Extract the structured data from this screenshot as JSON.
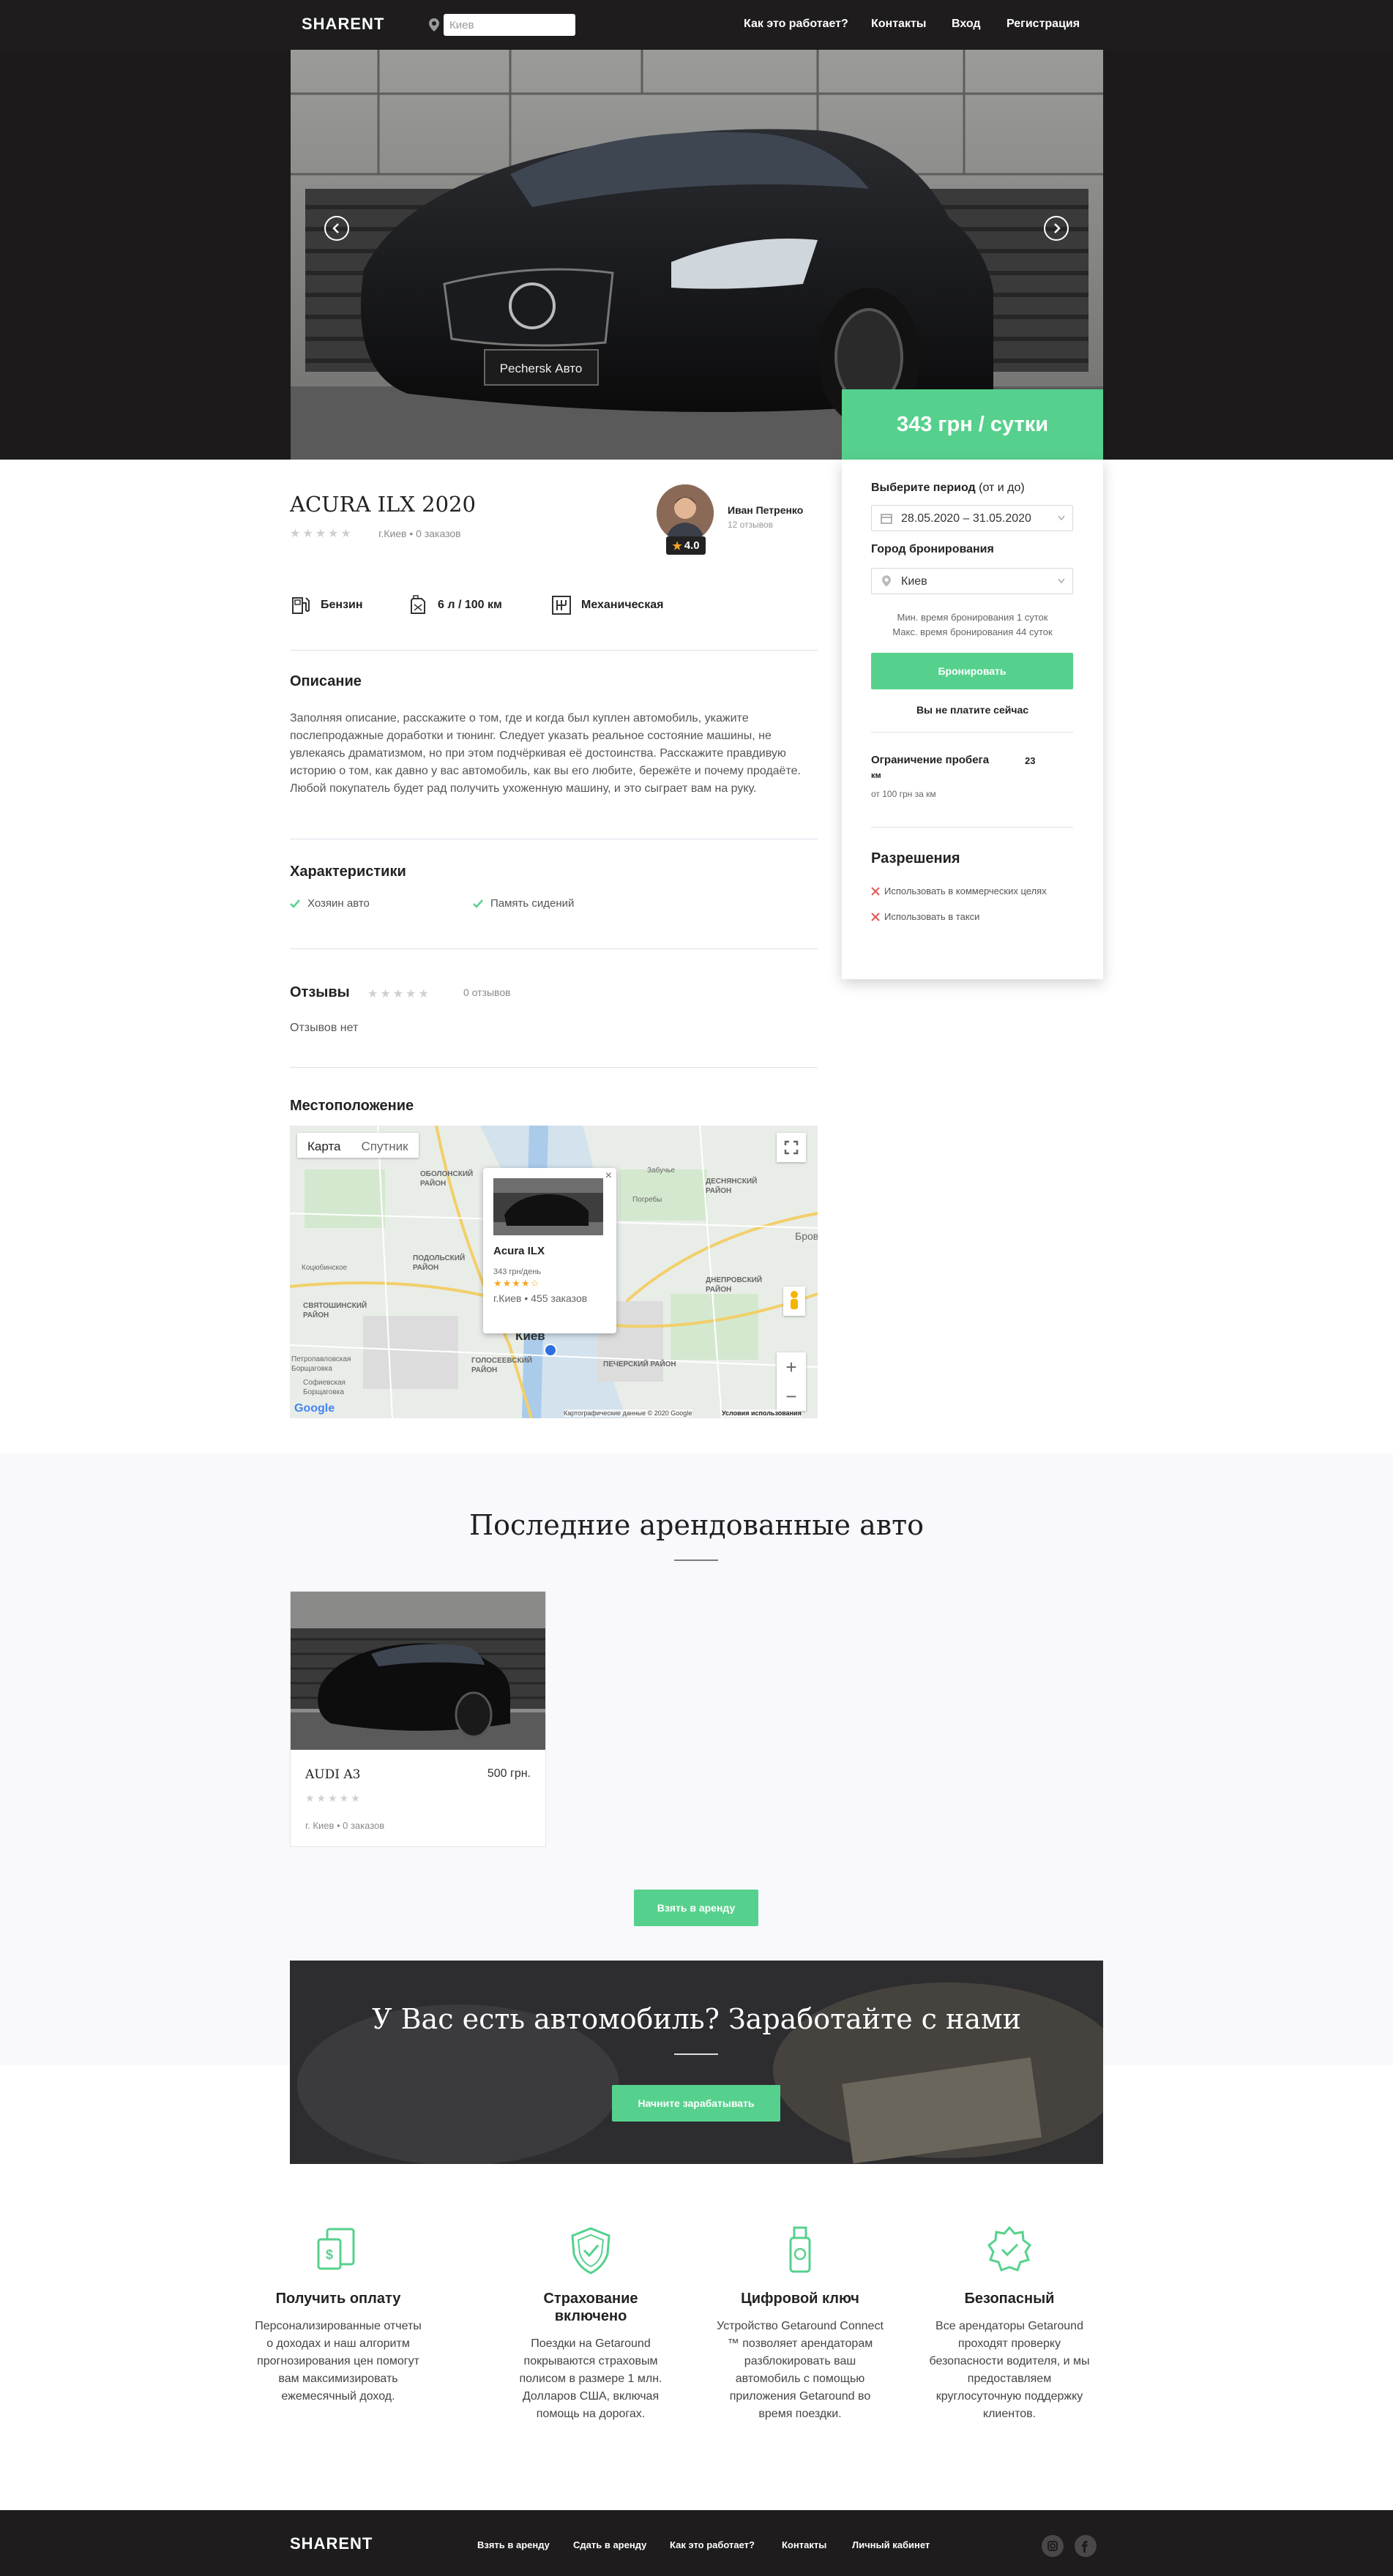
{
  "header": {
    "logo": "SHARENT",
    "search_value": "Киев",
    "nav": [
      "Как это работает?",
      "Контакты",
      "Вход",
      "Регистрация"
    ]
  },
  "hero": {
    "plate_text": "Pechersk Авто"
  },
  "price": {
    "label": "343 грн / сутки"
  },
  "booking": {
    "period_label": "Выберите период",
    "period_hint": "(от и до)",
    "dates": "28.05.2020 – 31.05.2020",
    "city_label": "Город бронирования",
    "city_value": "Киев",
    "min_time": "Мин. время бронирования 1 суток",
    "max_time": "Макс. время бронирования 44 суток",
    "book_button": "Бронировать",
    "no_pay": "Вы не платите сейчас",
    "mileage_label": "Ограничение пробега",
    "mileage_value": "23",
    "mileage_unit": "км",
    "mileage_price": "от 100 грн за км",
    "permissions_title": "Разрешения",
    "permissions": [
      "Использовать в коммерческих целях",
      "Использовать в такси"
    ]
  },
  "car": {
    "title": "ACURA ILX 2020",
    "stars": "★★★★★",
    "meta": "г.Киев • 0 заказов",
    "owner_name": "Иван Петренко",
    "owner_reviews": "12 отзывов",
    "owner_rating": "4.0",
    "specs": [
      "Бензин",
      "6 л / 100 км",
      "Механическая"
    ]
  },
  "description": {
    "title": "Описание",
    "text": "Заполняя описание, расскажите о том, где и когда был куплен автомобиль, укажите послепродажные доработки и тюнинг. Следует указать реальное состояние машины, не увлекаясь драматизмом, но при этом подчёркивая её достоинства. Расскажите правдивую историю о том, как давно у вас автомобиль, как вы его любите, бережёте и почему продаёте. Любой покупатель будет рад получить ухоженную машину, и это сыграет вам на руку."
  },
  "features": {
    "title": "Характеристики",
    "items": [
      "Хозяин авто",
      "Память сидений"
    ]
  },
  "reviews": {
    "title": "Отзывы",
    "stars": "★★★★★",
    "count": "0 отзывов",
    "empty": "Отзывов нет"
  },
  "location": {
    "title": "Местоположение",
    "map_tab_map": "Карта",
    "map_tab_sat": "Спутник",
    "popup_title": "Acura ILX",
    "popup_price": "343 грн/день",
    "popup_stars": "★★★★☆",
    "popup_meta": "г.Киев • 455 заказов",
    "popup_close": "×",
    "city_label": "Киев",
    "districts": [
      "ОБОЛОНСКИЙ РАЙОН",
      "ПОДОЛЬСКИЙ РАЙОН",
      "СВЯТОШИНСКИЙ РАЙОН",
      "ДЕСНЯНСКИЙ РАЙОН",
      "ДНЕПРОВСКИЙ РАЙОН",
      "Коцюбинское",
      "Петропавловская Борщаговка",
      "Софиевская Борщаговка",
      "Погребы",
      "Бров",
      "ПЕЧЕРСКИЙ РАЙОН",
      "ГОЛОСЕЕВСКИЙ РАЙОН",
      "Забучье"
    ],
    "zoom_in": "+",
    "zoom_out": "−",
    "google": "Google",
    "attribution": "Картографические данные © 2020 Google",
    "terms": "Условия использования"
  },
  "recent": {
    "title": "Последние арендованные авто",
    "card_name": "AUDI A3",
    "card_price": "500 грн.",
    "card_stars": "★★★★★",
    "card_meta": "г. Киев • 0 заказов",
    "rent_button": "Взять в аренду"
  },
  "earn": {
    "title": "У Вас есть автомобиль? Заработайте с нами",
    "button": "Начните зарабатывать"
  },
  "benefits": [
    {
      "title": "Получить оплату",
      "text": "Персонализированные отчеты о доходах и наш алгоритм прогнозирования цен помогут вам максимизировать ежемесячный доход."
    },
    {
      "title": "Страхование включено",
      "text": "Поездки на Getaround покрываются страховым полисом в размере 1 млн. Долларов США, включая помощь на дорогах."
    },
    {
      "title": "Цифровой ключ",
      "text": "Устройство Getaround Connect ™ позволяет арендаторам разблокировать ваш автомобиль с помощью приложения Getaround во время поездки."
    },
    {
      "title": "Безопасный",
      "text": "Все арендаторы Getaround проходят проверку безопасности водителя, и мы предоставляем круглосуточную поддержку клиентов."
    }
  ],
  "footer": {
    "logo": "SHARENT",
    "links": [
      "Взять в аренду",
      "Сдать в аренду",
      "Как это работает?",
      "Контакты",
      "Личный кабинет"
    ]
  },
  "colors": {
    "accent": "#56d18d",
    "dark": "#1e1c1c",
    "light_bg": "#f8f8fd"
  }
}
